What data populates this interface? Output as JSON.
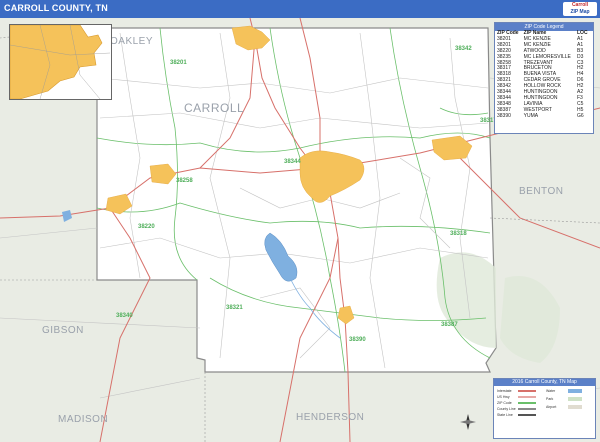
{
  "title": "CARROLL COUNTY, TN",
  "brand": {
    "line1": "Carroll",
    "line2": "ZIP Map"
  },
  "neighbor_counties": [
    {
      "name": "OAKLEY",
      "key": "oakley"
    },
    {
      "name": "CARROLL",
      "key": "carroll"
    },
    {
      "name": "BENTON",
      "key": "benton"
    },
    {
      "name": "GIBSON",
      "key": "gibson"
    },
    {
      "name": "MADISON",
      "key": "madison"
    },
    {
      "name": "HENDERSON",
      "key": "henderson"
    }
  ],
  "zip_labels": [
    "38201",
    "38342",
    "38344",
    "38258",
    "38220",
    "38318",
    "38340",
    "38321",
    "38387",
    "38390",
    "38317"
  ],
  "legend": {
    "header": "ZIP Code Legend",
    "columns": [
      "ZIP Code",
      "ZIP Name",
      "LOC"
    ],
    "rows": [
      [
        "38201",
        "MC KENZIE",
        "A1"
      ],
      [
        "38201",
        "MC KENZIE",
        "A1"
      ],
      [
        "38220",
        "ATWOOD",
        "B3"
      ],
      [
        "38235",
        "MC LEMORESVILLE",
        "D3"
      ],
      [
        "38258",
        "TREZEVANT",
        "C3"
      ],
      [
        "38317",
        "BRUCETON",
        "H2"
      ],
      [
        "38318",
        "BUENA VISTA",
        "H4"
      ],
      [
        "38321",
        "CEDAR GROVE",
        "D6"
      ],
      [
        "38342",
        "HOLLOW ROCK",
        "H2"
      ],
      [
        "38344",
        "HUNTINGDON",
        "A2"
      ],
      [
        "38344",
        "HUNTINGDON",
        "F3"
      ],
      [
        "38348",
        "LAVINIA",
        "C5"
      ],
      [
        "38387",
        "WESTPORT",
        "H5"
      ],
      [
        "38390",
        "YUMA",
        "G6"
      ]
    ]
  },
  "map_legend": {
    "header": "2016 Carroll County, TN Map",
    "items": [
      "Interstate",
      "US Hwy",
      "ZIP Code",
      "County Line",
      "State Line",
      "Water",
      "Park",
      "Airport"
    ]
  },
  "colors": {
    "title_bar": "#3b6cc4",
    "land": "#ffffff",
    "outside": "#e9ece4",
    "urban": "#f5c25a",
    "water": "#7fb0e0",
    "zip_boundary": "#6abf6a",
    "road_major": "#d7706a",
    "road_minor": "#c4c4c4",
    "county_line": "#8a8a8a"
  }
}
